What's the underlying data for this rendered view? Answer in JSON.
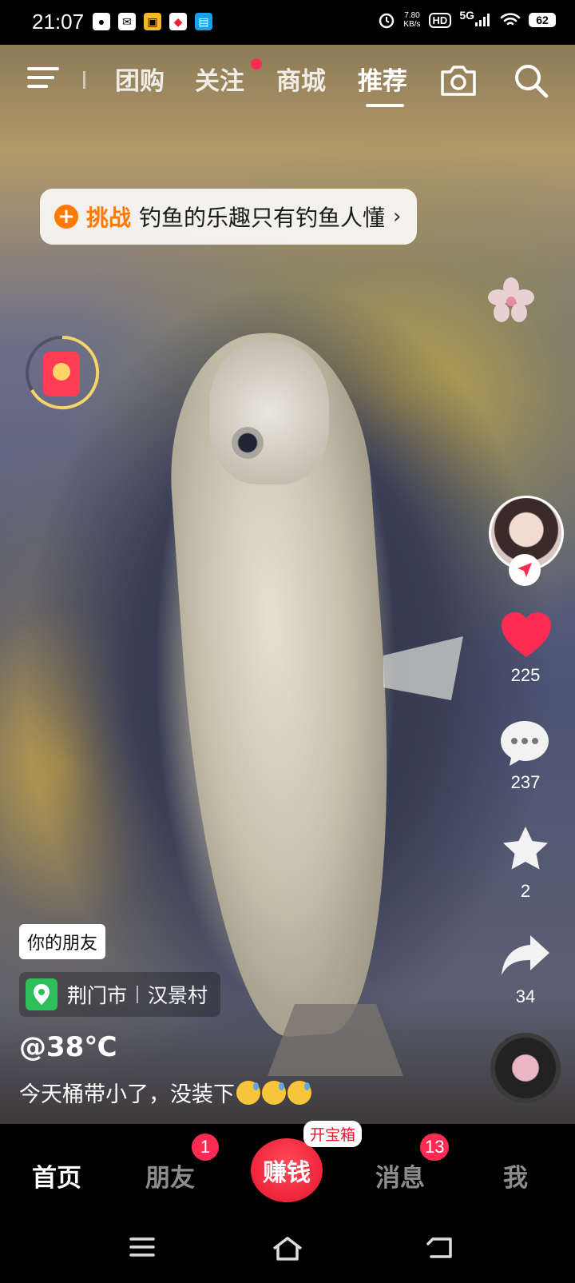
{
  "status_bar": {
    "time": "21:07",
    "notification_icons": [
      "wechat-icon",
      "mail-icon",
      "app-icon",
      "map-icon",
      "app-icon"
    ],
    "net_speed_value": "7.80",
    "net_speed_unit": "KB/s",
    "hd_label": "HD",
    "network_label": "5G",
    "battery": "62"
  },
  "top_nav": {
    "tabs": [
      "团购",
      "关注",
      "商城",
      "推荐"
    ],
    "active_tab": "推荐",
    "follow_has_dot": true
  },
  "challenge": {
    "tag": "挑战",
    "title": "钓鱼的乐趣只有钓鱼人懂",
    "chevron": "›"
  },
  "rail": {
    "likes": "225",
    "comments": "237",
    "favorites": "2",
    "shares": "34"
  },
  "post": {
    "friend_tag": "你的朋友",
    "location_city": "荆门市",
    "location_village": "汉景村",
    "author": "@38℃",
    "caption": "今天桶带小了，没装下"
  },
  "bottom_tabs": {
    "home": "首页",
    "friends": "朋友",
    "friends_badge": "1",
    "earn": "赚钱",
    "earn_bubble": "开宝箱",
    "messages": "消息",
    "messages_badge": "13",
    "me": "我"
  },
  "colors": {
    "accent_red": "#fe2c55",
    "challenge_orange": "#ff7a00",
    "location_green": "#2fbf5a"
  }
}
